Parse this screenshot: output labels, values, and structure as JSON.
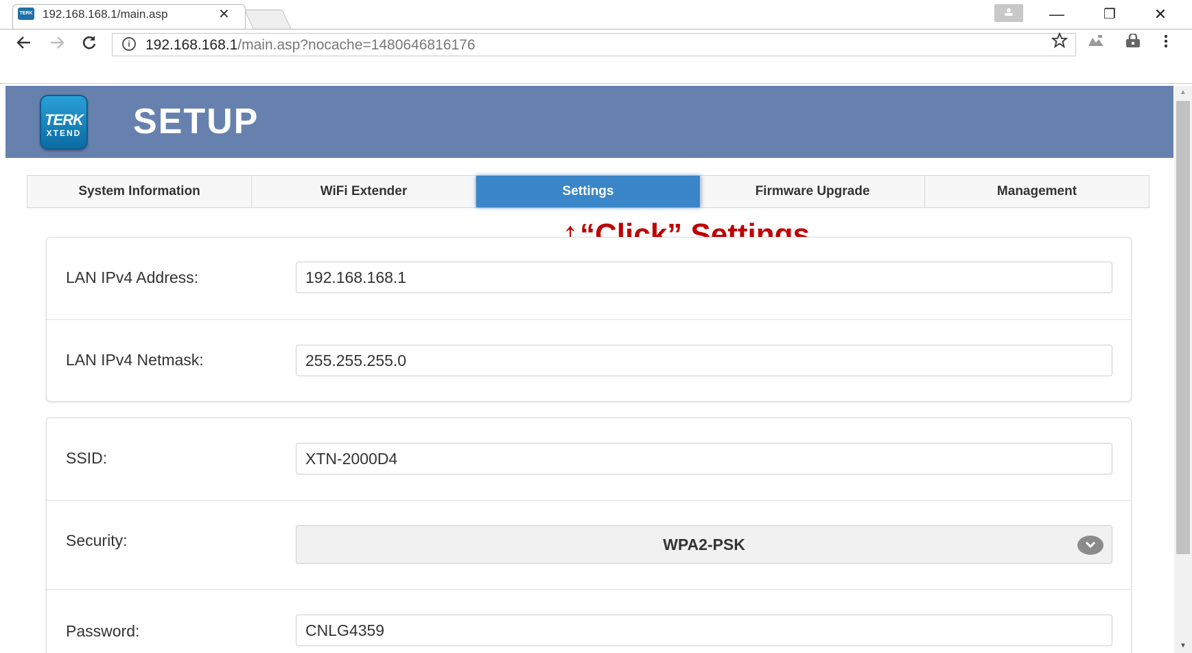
{
  "browser": {
    "tab_title": "192.168.168.1/main.asp",
    "tab_close": "✕",
    "favicon_text": "TERK",
    "url_host": "192.168.168.1",
    "url_path": "/main.asp?nocache=1480646816176",
    "window_controls": {
      "minimize": "—",
      "restore": "❐",
      "close": "✕"
    },
    "icons": [
      "back-icon",
      "forward-icon",
      "reload-icon",
      "info-icon",
      "star-icon",
      "extension-icon",
      "extension-icon",
      "menu-icon"
    ]
  },
  "header": {
    "logo_top": "TERK",
    "logo_bottom": "XTEND",
    "title": "SETUP"
  },
  "nav": {
    "tabs": [
      {
        "label": "System Information"
      },
      {
        "label": "WiFi Extender"
      },
      {
        "label": "Settings",
        "active": true
      },
      {
        "label": "Firmware Upgrade"
      },
      {
        "label": "Management"
      }
    ]
  },
  "annotation": {
    "arrow": "↑",
    "text": "“Click” Settings",
    "color": "#c00000"
  },
  "lan": {
    "ipv4_address_label": "LAN IPv4 Address:",
    "ipv4_address_value": "192.168.168.1",
    "ipv4_netmask_label": "LAN IPv4 Netmask:",
    "ipv4_netmask_value": "255.255.255.0"
  },
  "wifi": {
    "ssid_label": "SSID:",
    "ssid_value": "XTN-2000D4",
    "security_label": "Security:",
    "security_value": "WPA2-PSK",
    "password_label": "Password:",
    "password_value": "CNLG4359"
  },
  "colors": {
    "header_bg": "#6781ae",
    "active_tab": "#3a86c8",
    "annotation": "#c00000"
  }
}
